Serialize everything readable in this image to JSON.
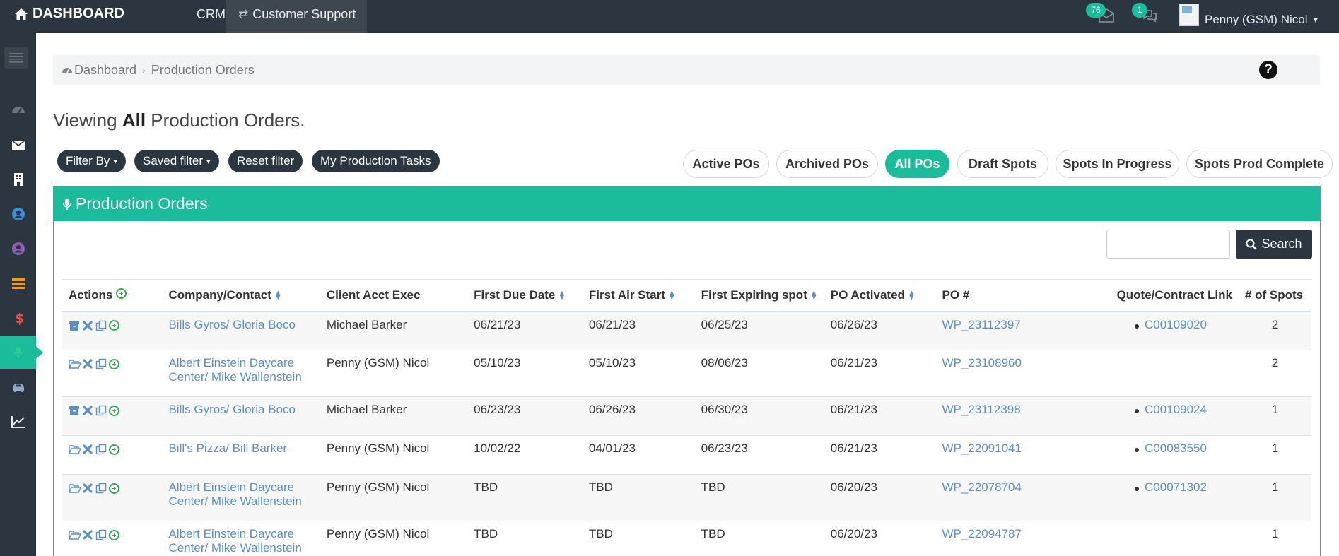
{
  "topbar": {
    "brand": "DASHBOARD",
    "crm_label": "CRM",
    "customer_support_label": "Customer Support",
    "mail_count": "76",
    "chat_count": "1",
    "user_name": "Penny (GSM) Nicol"
  },
  "sidebar": {
    "items": [
      "dashboard-icon",
      "envelope-icon",
      "building-icon",
      "user-circle-icon",
      "user-circle-icon",
      "list-icon",
      "dollar-icon",
      "microphone-icon",
      "car-icon",
      "chart-icon"
    ],
    "active": "microphone-icon"
  },
  "breadcrumb": {
    "home": "Dashboard",
    "current": "Production Orders"
  },
  "page": {
    "title_prefix": "Viewing",
    "title_bold": "All",
    "title_suffix": "Production Orders."
  },
  "filters": {
    "filter_by": "Filter By",
    "saved_filter": "Saved filter",
    "reset_filter": "Reset filter",
    "my_tasks": "My Production Tasks"
  },
  "tabs": [
    {
      "label": "Active POs",
      "active": false
    },
    {
      "label": "Archived POs",
      "active": false
    },
    {
      "label": "All POs",
      "active": true
    },
    {
      "label": "Draft Spots",
      "active": false
    },
    {
      "label": "Spots In Progress",
      "active": false
    },
    {
      "label": "Spots Prod Complete",
      "active": false
    }
  ],
  "panel": {
    "title": "Production Orders",
    "search_button": "Search",
    "search_value": ""
  },
  "table": {
    "headers": {
      "actions": "Actions",
      "company": "Company/Contact",
      "exec": "Client Acct Exec",
      "due": "First Due Date",
      "air": "First Air Start",
      "expiring": "First Expiring spot",
      "activated": "PO Activated",
      "po": "PO #",
      "quote": "Quote/Contract Link",
      "spots": "# of Spots"
    },
    "rows": [
      {
        "first_icon": "archive-icon",
        "company_line1": "Bills Gyros/ Gloria Boco",
        "company_line2": "",
        "exec": "Michael Barker",
        "due": "06/21/23",
        "air": "06/21/23",
        "expiring": "06/25/23",
        "activated": "06/26/23",
        "po": "WP_23112397",
        "quote": "C00109020",
        "spots": "2"
      },
      {
        "first_icon": "folder-open-icon",
        "company_line1": "Albert Einstein Daycare",
        "company_line2": "Center/ Mike Wallenstein",
        "exec": "Penny (GSM) Nicol",
        "due": "05/10/23",
        "air": "05/10/23",
        "expiring": "08/06/23",
        "activated": "06/21/23",
        "po": "WP_23108960",
        "quote": "",
        "spots": "2"
      },
      {
        "first_icon": "archive-icon",
        "company_line1": "Bills Gyros/ Gloria Boco",
        "company_line2": "",
        "exec": "Michael Barker",
        "due": "06/23/23",
        "air": "06/26/23",
        "expiring": "06/30/23",
        "activated": "06/21/23",
        "po": "WP_23112398",
        "quote": "C00109024",
        "spots": "1"
      },
      {
        "first_icon": "folder-open-icon",
        "company_line1": "Bill's Pizza/ Bill Barker",
        "company_line2": "",
        "exec": "Penny (GSM) Nicol",
        "due": "10/02/22",
        "air": "04/01/23",
        "expiring": "06/23/23",
        "activated": "06/21/23",
        "po": "WP_22091041",
        "quote": "C00083550",
        "spots": "1"
      },
      {
        "first_icon": "folder-open-icon",
        "company_line1": "Albert Einstein Daycare",
        "company_line2": "Center/ Mike Wallenstein",
        "exec": "Penny (GSM) Nicol",
        "due": "TBD",
        "air": "TBD",
        "expiring": "TBD",
        "activated": "06/20/23",
        "po": "WP_22078704",
        "quote": "C00071302",
        "spots": "1"
      },
      {
        "first_icon": "folder-open-icon",
        "company_line1": "Albert Einstein Daycare",
        "company_line2": "Center/ Mike Wallenstein",
        "exec": "Penny (GSM) Nicol",
        "due": "TBD",
        "air": "TBD",
        "expiring": "TBD",
        "activated": "06/20/23",
        "po": "WP_22094787",
        "quote": "",
        "spots": "1"
      }
    ]
  },
  "colors": {
    "topbar": "#2b3640",
    "accent": "#1abc9c",
    "link": "#5b8fc7"
  }
}
